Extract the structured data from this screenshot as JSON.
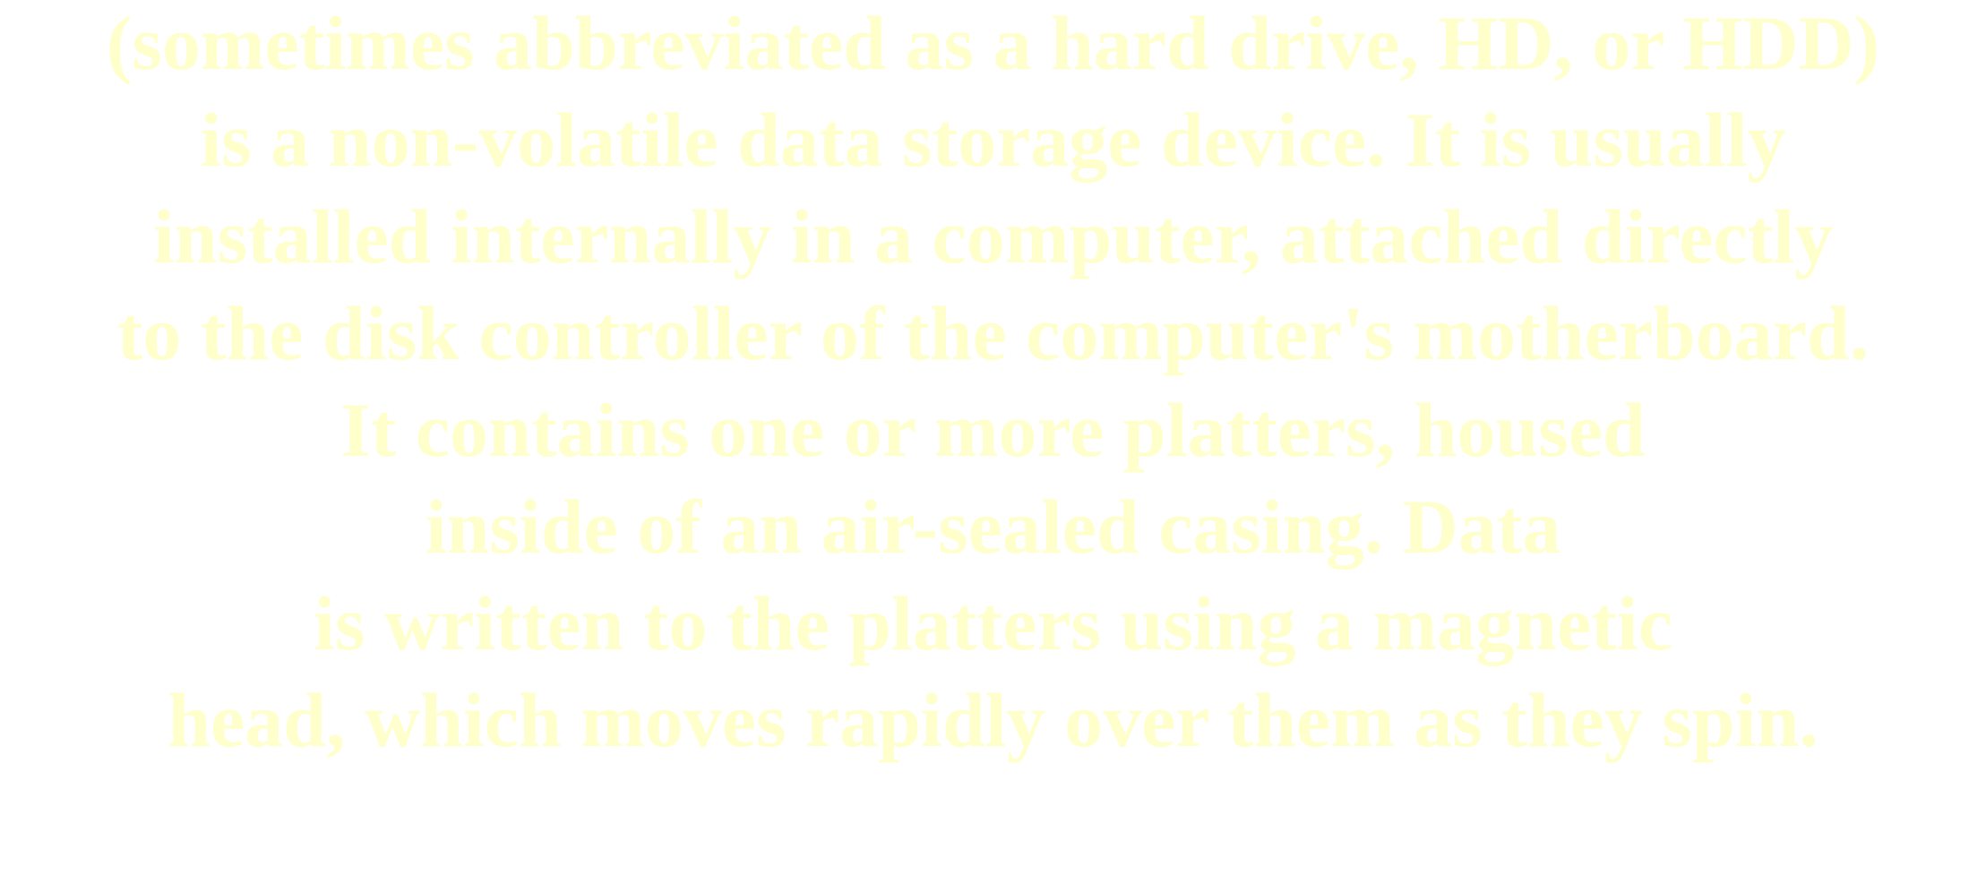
{
  "paragraph": {
    "lines": [
      "(sometimes abbreviated as a hard drive, HD, or HDD)",
      "is a non-volatile data storage device. It is usually",
      "installed internally in a computer, attached directly",
      "to the disk controller of the computer's motherboard.",
      "It contains one or more platters, housed",
      "inside of an air-sealed casing. Data",
      "is written to the platters using a magnetic",
      "head, which moves rapidly over them as they spin."
    ],
    "text_color": "#ffffcc",
    "background_color": "#ffffff"
  }
}
